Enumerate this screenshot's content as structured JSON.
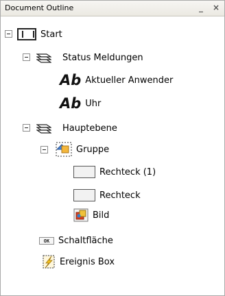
{
  "panel": {
    "title": "Document Outline",
    "minimize_glyph": "_",
    "close_glyph": "×"
  },
  "tree": {
    "start": {
      "label": "Start",
      "icon": "layout-frame-icon"
    },
    "status_meldungen": {
      "label": "Status Meldungen",
      "icon": "layers-icon"
    },
    "aktueller_anwender": {
      "label": "Aktueller Anwender",
      "icon": "text-ab-icon",
      "icon_text": "Ab"
    },
    "uhr": {
      "label": "Uhr",
      "icon": "text-ab-icon",
      "icon_text": "Ab"
    },
    "hauptebene": {
      "label": "Hauptebene",
      "icon": "layers-icon"
    },
    "gruppe": {
      "label": "Gruppe",
      "icon": "group-icon"
    },
    "rechteck_1": {
      "label": "Rechteck (1)",
      "icon": "rectangle-icon"
    },
    "rechteck": {
      "label": "Rechteck",
      "icon": "rectangle-icon"
    },
    "bild": {
      "label": "Bild",
      "icon": "image-icon"
    },
    "schaltflaeche": {
      "label": "Schaltfläche",
      "icon": "button-icon",
      "icon_text": "OK"
    },
    "ereignis_box": {
      "label": "Ereignis Box",
      "icon": "event-box-icon"
    }
  }
}
